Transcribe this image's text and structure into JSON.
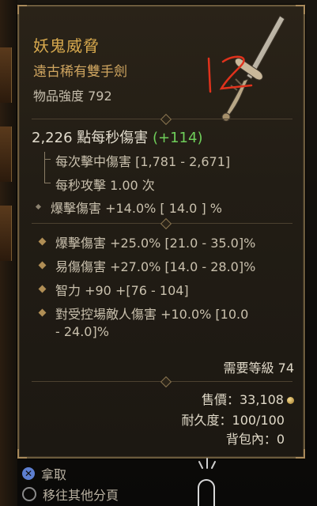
{
  "item": {
    "name": "妖鬼威脅",
    "type": "遠古稀有雙手劍",
    "power_label": "物品強度 792"
  },
  "annotation": {
    "handwritten_text": "12"
  },
  "weapon": {
    "dps_value": "2,226",
    "dps_label": "點每秒傷害",
    "dps_delta": "(+114)",
    "damage_per_hit": "每次擊中傷害 [1,781 - 2,671]",
    "attacks_per_second": "每秒攻擊 1.00 次"
  },
  "implicit": {
    "crit_damage": "爆擊傷害 +14.0% [ 14.0 ] %"
  },
  "affixes": [
    {
      "line1": "爆擊傷害 +25.0% [21.0 - 35.0]%",
      "line2": ""
    },
    {
      "line1": "易傷傷害 +27.0% [14.0 - 28.0]%",
      "line2": ""
    },
    {
      "line1": "智力 +90 +[76 - 104]",
      "line2": ""
    },
    {
      "line1": "對受控場敵人傷害 +10.0% [10.0",
      "line2": "- 24.0]%"
    }
  ],
  "footer": {
    "required_level": "需要等級 74",
    "sell_price": "售價：33,108",
    "durability": "耐久度：100/100",
    "in_bag": "背包內：0"
  },
  "controls": {
    "take_label": "拿取",
    "move_label": "移往其他分頁"
  },
  "colors": {
    "legendary_gold": "#d7a94e",
    "delta_green": "#6fce5a",
    "text": "#c9c0ad",
    "annotation_red": "#e0321c"
  },
  "icons": {
    "weapon": "two-handed-sword-icon",
    "gold": "gold-coin-icon",
    "x_button": "x-button-icon",
    "rs_button": "right-stick-icon"
  }
}
